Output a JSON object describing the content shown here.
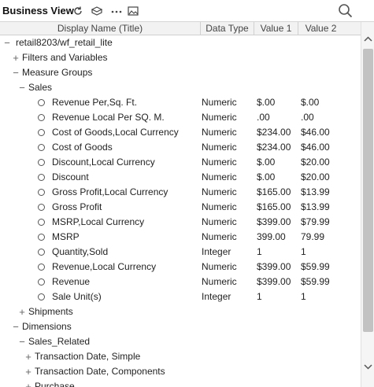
{
  "titlebar": {
    "title": "Business View",
    "icons": [
      "refresh-icon",
      "package-icon",
      "more-icon",
      "image-icon",
      "search-icon"
    ]
  },
  "columns": {
    "display_name": "Display Name (Title)",
    "data_type": "Data Type",
    "value1": "Value 1",
    "value2": "Value 2"
  },
  "tree": [
    {
      "label": "retail8203/wf_retail_lite",
      "expander": "−",
      "kind": "node",
      "depth": 0
    },
    {
      "label": "Filters and Variables",
      "expander": "+",
      "kind": "node",
      "depth": 1
    },
    {
      "label": "Measure Groups",
      "expander": "−",
      "kind": "node",
      "depth": 1
    },
    {
      "label": "Sales",
      "expander": "−",
      "kind": "node",
      "depth": 2
    },
    {
      "label": "Revenue Per,Sq. Ft.",
      "kind": "field",
      "depth": 3,
      "dtype": "Numeric",
      "v1": "$.00",
      "v2": "$.00"
    },
    {
      "label": "Revenue Local Per SQ. M.",
      "kind": "field",
      "depth": 3,
      "dtype": "Numeric",
      "v1": ".00",
      "v2": ".00"
    },
    {
      "label": "Cost of Goods,Local Currency",
      "kind": "field",
      "depth": 3,
      "dtype": "Numeric",
      "v1": "$234.00",
      "v2": "$46.00"
    },
    {
      "label": "Cost of Goods",
      "kind": "field",
      "depth": 3,
      "dtype": "Numeric",
      "v1": "$234.00",
      "v2": "$46.00"
    },
    {
      "label": "Discount,Local Currency",
      "kind": "field",
      "depth": 3,
      "dtype": "Numeric",
      "v1": "$.00",
      "v2": "$20.00"
    },
    {
      "label": "Discount",
      "kind": "field",
      "depth": 3,
      "dtype": "Numeric",
      "v1": "$.00",
      "v2": "$20.00"
    },
    {
      "label": "Gross Profit,Local Currency",
      "kind": "field",
      "depth": 3,
      "dtype": "Numeric",
      "v1": "$165.00",
      "v2": "$13.99"
    },
    {
      "label": "Gross Profit",
      "kind": "field",
      "depth": 3,
      "dtype": "Numeric",
      "v1": "$165.00",
      "v2": "$13.99"
    },
    {
      "label": "MSRP,Local Currency",
      "kind": "field",
      "depth": 3,
      "dtype": "Numeric",
      "v1": "$399.00",
      "v2": "$79.99"
    },
    {
      "label": "MSRP",
      "kind": "field",
      "depth": 3,
      "dtype": "Numeric",
      "v1": "399.00",
      "v2": "79.99"
    },
    {
      "label": "Quantity,Sold",
      "kind": "field",
      "depth": 3,
      "dtype": "Integer",
      "v1": "1",
      "v2": "1"
    },
    {
      "label": "Revenue,Local Currency",
      "kind": "field",
      "depth": 3,
      "dtype": "Numeric",
      "v1": "$399.00",
      "v2": "$59.99"
    },
    {
      "label": "Revenue",
      "kind": "field",
      "depth": 3,
      "dtype": "Numeric",
      "v1": "$399.00",
      "v2": "$59.99"
    },
    {
      "label": "Sale Unit(s)",
      "kind": "field",
      "depth": 3,
      "dtype": "Integer",
      "v1": "1",
      "v2": "1"
    },
    {
      "label": "Shipments",
      "expander": "+",
      "kind": "node",
      "depth": 2
    },
    {
      "label": "Dimensions",
      "expander": "−",
      "kind": "node",
      "depth": 1
    },
    {
      "label": "Sales_Related",
      "expander": "−",
      "kind": "node",
      "depth": 2
    },
    {
      "label": "Transaction Date, Simple",
      "expander": "+",
      "kind": "node",
      "depth": 3
    },
    {
      "label": "Transaction Date, Components",
      "expander": "+",
      "kind": "node",
      "depth": 3
    },
    {
      "label": "Purchase",
      "expander": "+",
      "kind": "node",
      "depth": 3
    }
  ]
}
